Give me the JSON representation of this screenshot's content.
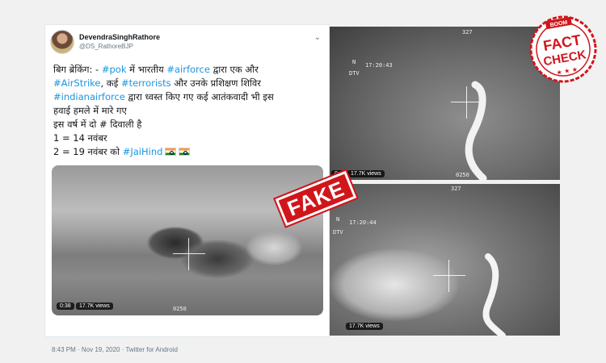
{
  "tweet": {
    "display_name": "DevendraSinghRathore",
    "handle": "@DS_RathoreBJP",
    "more_icon": "chevron-down-icon",
    "lines": [
      [
        {
          "t": "बिग ब्रेकिंग: - "
        },
        {
          "t": "#pok",
          "h": true
        },
        {
          "t": " में भारतीय  "
        },
        {
          "t": "#airforce",
          "h": true
        },
        {
          "t": " द्वारा एक और"
        }
      ],
      [
        {
          "t": "#AirStrike",
          "h": true
        },
        {
          "t": ", कई "
        },
        {
          "t": "#terrorists",
          "h": true
        },
        {
          "t": " और उनके प्रशिक्षण शिविर"
        }
      ],
      [
        {
          "t": "#indianairforce",
          "h": true
        },
        {
          "t": " द्वारा ध्वस्त किए गए कई आतंकवादी भी इस"
        }
      ],
      [
        {
          "t": "हवाई हमले में मारे गए"
        }
      ],
      [
        {
          "t": " इस वर्ष में दो # दिवाली है"
        }
      ],
      [
        {
          "t": " 1 = 14 नवंबर"
        }
      ],
      [
        {
          "t": " 2 = 19 नवंबर को "
        },
        {
          "t": "#JaiHind",
          "h": true
        },
        {
          "t": " 🇮🇳🇮🇳",
          "flags": 2
        }
      ]
    ],
    "video": {
      "time": "0:38",
      "views": "17.7K views",
      "osd_code": "0250"
    },
    "footer": "8:43 PM · Nov 19, 2020 · Twitter for Android"
  },
  "video_top": {
    "time": "0:40",
    "views": "17.7K views",
    "timestamp": "17:20:43",
    "mode": "DTV",
    "heading": "327",
    "north": "N",
    "osd_code": "0250"
  },
  "video_bottom": {
    "views": "17.7K views",
    "timestamp": "17:20:44",
    "mode": "DTV",
    "heading": "327",
    "north": "N"
  },
  "stamp": {
    "label": "FAKE"
  },
  "logo": {
    "top": "BOOM",
    "line1": "FACT",
    "line2": "CHECK",
    "color": "#d0161b"
  },
  "colors": {
    "hashtag": "#1b95e0",
    "stamp_red": "#d0161b"
  }
}
